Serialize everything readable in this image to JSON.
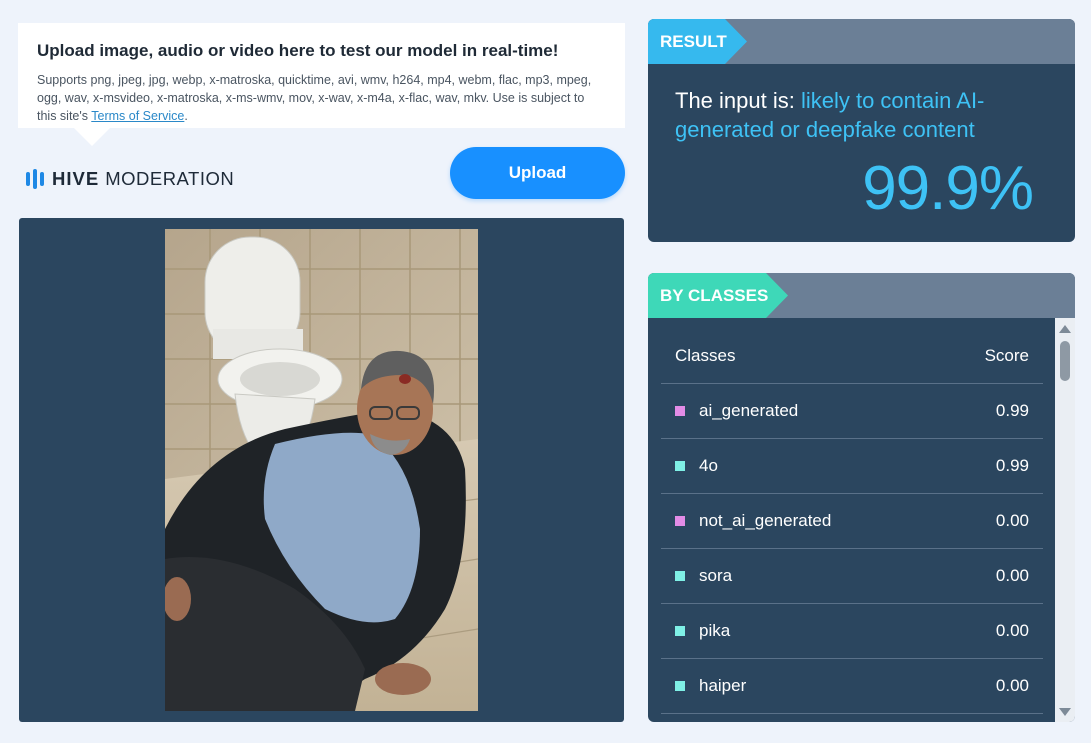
{
  "upload_info": {
    "title": "Upload image, audio or video here to test our model in real-time!",
    "supported_text": "Supports png, jpeg, jpg, webp, x-matroska, quicktime, avi, wmv, h264, mp4, webm, flac, mp3, mpeg, ogg, wav, x-msvideo, x-matroska, x-ms-wmv, mov, x-wav, x-m4a, x-flac, wav, mkv. Use is subject to this site's ",
    "terms_link": "Terms of Service",
    "terms_suffix": "."
  },
  "logo": {
    "brand": "HIVE",
    "product": "MODERATION"
  },
  "upload_button": {
    "label": "Upload"
  },
  "preview": {
    "image_icon": "photo-preview"
  },
  "result": {
    "tag": "RESULT",
    "prefix": "The input is: ",
    "verdict": "likely to contain AI-generated or deepfake content",
    "percentage": "99.9%"
  },
  "by_classes": {
    "tag": "BY CLASSES",
    "header_class": "Classes",
    "header_score": "Score",
    "rows": [
      {
        "name": "ai_generated",
        "score": "0.99",
        "color": "#e38ce6"
      },
      {
        "name": "4o",
        "score": "0.99",
        "color": "#7ff0e6"
      },
      {
        "name": "not_ai_generated",
        "score": "0.00",
        "color": "#e38ce6"
      },
      {
        "name": "sora",
        "score": "0.00",
        "color": "#7ff0e6"
      },
      {
        "name": "pika",
        "score": "0.00",
        "color": "#7ff0e6"
      },
      {
        "name": "haiper",
        "score": "0.00",
        "color": "#7ff0e6"
      }
    ]
  },
  "colors": {
    "accent": "#1890ff",
    "panel": "#2b465f",
    "result_accent": "#3ec2f5",
    "classes_tag": "#3ed8b8"
  }
}
